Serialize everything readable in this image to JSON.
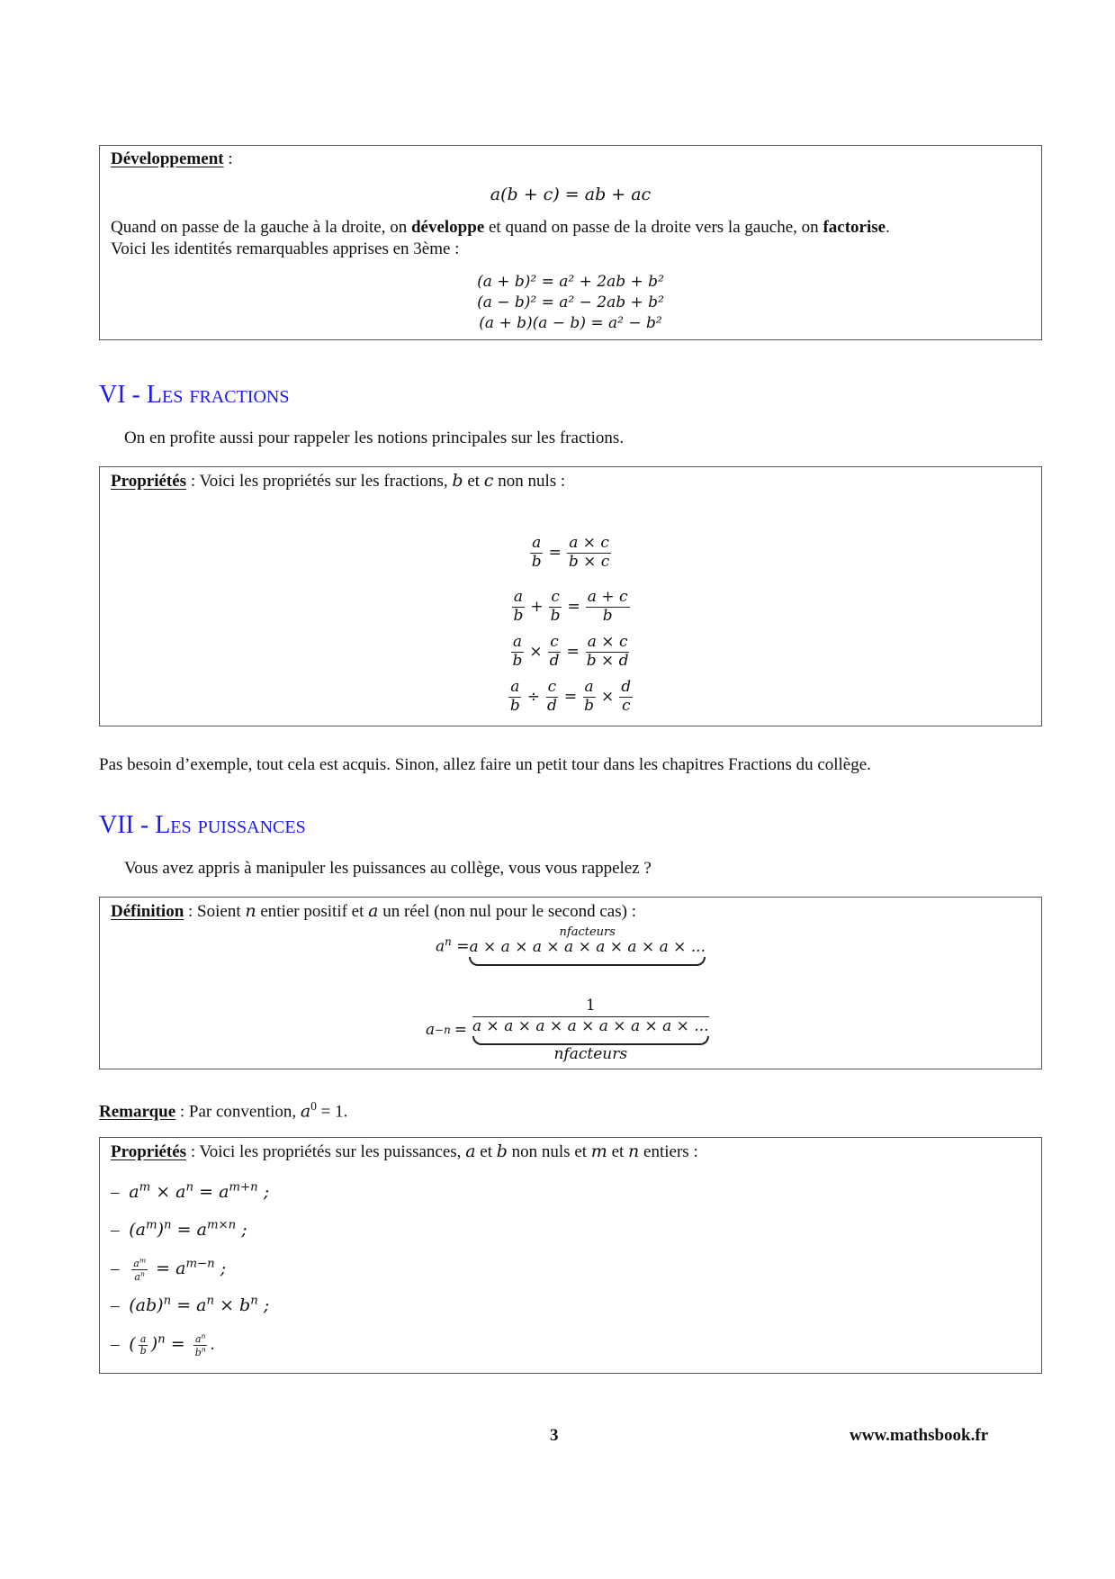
{
  "developpement_box": {
    "label": "Développement",
    "label_suffix": " :",
    "formula": "a(b + c) = ab + ac",
    "text_part1": "Quand on passe de la gauche à la droite, on ",
    "text_bold1": "développe",
    "text_part2": " et quand on passe de la droite vers la gauche, on ",
    "text_bold2": "factorise",
    "text_part3": ".",
    "text_line2": "Voici les identités remarquables apprises en 3ème :",
    "identities": [
      "(a + b)² = a² + 2ab + b²",
      "(a − b)² = a² − 2ab + b²",
      "(a + b)(a − b) = a² − b²"
    ]
  },
  "section6": {
    "number": "VI - ",
    "title": "Les fractions",
    "intro": "On en profite aussi pour rappeler les notions principales sur les fractions.",
    "box": {
      "label": "Propriétés",
      "text_part1": " : Voici les propriétés sur les fractions, ",
      "var_b": "b",
      "text_et": " et ",
      "var_c": "c",
      "text_part2": " non nuls :",
      "rules": [
        {
          "lhs": [
            [
              "a",
              "b"
            ]
          ],
          "ops": [],
          "rhs": [
            [
              "a × c",
              "b × c"
            ]
          ],
          "rhs_ops": []
        },
        {
          "lhs": [
            [
              "a",
              "b"
            ],
            [
              "c",
              "b"
            ]
          ],
          "ops": [
            "+"
          ],
          "rhs": [
            [
              "a + c",
              "b"
            ]
          ],
          "rhs_ops": []
        },
        {
          "lhs": [
            [
              "a",
              "b"
            ],
            [
              "c",
              "d"
            ]
          ],
          "ops": [
            "×"
          ],
          "rhs": [
            [
              "a × c",
              "b × d"
            ]
          ],
          "rhs_ops": []
        },
        {
          "lhs": [
            [
              "a",
              "b"
            ],
            [
              "c",
              "d"
            ]
          ],
          "ops": [
            "÷"
          ],
          "rhs": [
            [
              "a",
              "b"
            ],
            [
              "d",
              "c"
            ]
          ],
          "rhs_ops": [
            "×"
          ]
        }
      ]
    },
    "after_text": "Pas besoin d’exemple, tout cela est acquis. Sinon, allez faire un petit tour dans les chapitres Fractions du collège."
  },
  "section7": {
    "number": "VII - ",
    "title": "Les puissances",
    "intro": "Vous avez appris à manipuler les puissances au collège, vous vous rappelez ?",
    "definition_box": {
      "label": "Définition",
      "text_part1": " : Soient ",
      "var_n": "n",
      "text_part2": " entier positif et ",
      "var_a": "a",
      "text_part3": " un réel (non nul pour le second cas) :",
      "pos_lhs_base": "a",
      "pos_lhs_exp": "n",
      "equals": "=",
      "product": "a × a × a × a × a × a × a × ...",
      "brace_label": "nfacteurs",
      "neg_lhs_base": "a",
      "neg_lhs_exp": "−n",
      "numerator": "1"
    },
    "remark": {
      "label": "Remarque",
      "text": " : Par convention, ",
      "math_base": "a",
      "math_exp": "0",
      "math_rest": " = 1."
    },
    "properties_box": {
      "label": "Propriétés",
      "text_part1": " : Voici les propriétés sur les puissances, ",
      "var_a": "a",
      "text_et1": " et ",
      "var_b": "b",
      "text_part2": " non nuls et ",
      "var_m": "m",
      "text_et2": " et ",
      "var_n": "n",
      "text_part3": " entiers :",
      "items": [
        "a^m × a^n = a^{m+n} ;",
        "(a^m)^n = a^{m×n} ;",
        "a^m / a^n = a^{m−n} ;",
        "(ab)^n = a^n × b^n ;",
        "(a/b)^n = a^n / b^n ."
      ],
      "bullet": "–"
    }
  },
  "footer": {
    "page_number": "3",
    "website": "www.mathsbook.fr"
  }
}
